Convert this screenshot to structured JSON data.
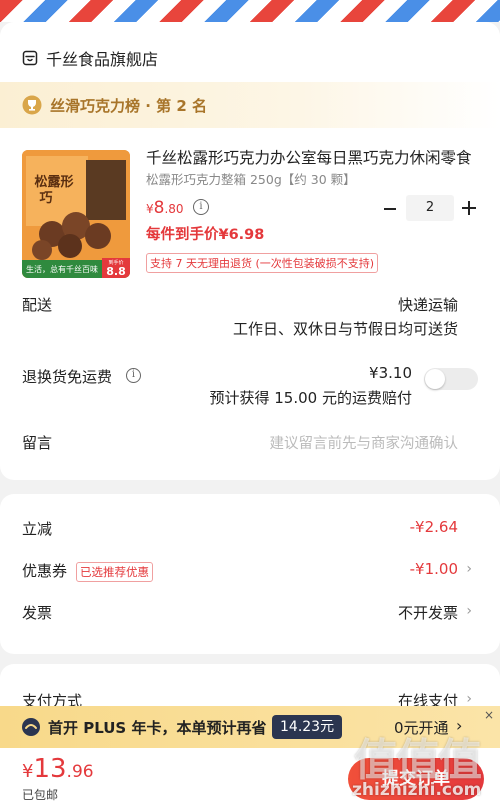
{
  "store": {
    "name": "千丝食品旗舰店",
    "icon": "store-icon"
  },
  "ranking": {
    "text": "丝滑巧克力榜 · 第 2 名",
    "icon": "trophy-icon"
  },
  "product": {
    "title": "千丝松露形巧克力办公室每日黑巧克力休闲零食",
    "spec": "松露形巧克力整箱 250g【约 30 颗】",
    "price_currency": "¥",
    "price_int": "8",
    "price_dec": ".80",
    "quantity": "2",
    "per_item_price": "每件到手价¥6.98",
    "return_policy": "支持 7 天无理由退货 (一次性包装破损不支持)",
    "image": {
      "box_text": "松露形巧克力",
      "badge_left": "生活，总有千丝百味",
      "badge_price": "8.8",
      "badge_price_label": "到手价"
    }
  },
  "delivery": {
    "label": "配送",
    "method": "快递运输",
    "schedule": "工作日、双休日与节假日均可送货"
  },
  "return_shipping": {
    "label": "退换货免运费",
    "price": "¥3.10",
    "note_prefix": "预计获得 ",
    "note_amount": "15.00",
    "note_suffix": " 元的运费赔付",
    "enabled": false
  },
  "message": {
    "label": "留言",
    "placeholder": "建议留言前先与商家沟通确认"
  },
  "discounts": {
    "instant_label": "立减",
    "instant_value": "-¥2.64",
    "coupon_label": "优惠券",
    "coupon_tag": "已选推荐优惠",
    "coupon_value": "-¥1.00",
    "invoice_label": "发票",
    "invoice_value": "不开发票"
  },
  "payment": {
    "label": "支付方式",
    "value": "在线支付"
  },
  "plus_banner": {
    "text": "首开 PLUS 年卡，本单预计再省",
    "save_amount": "14.23元",
    "button": "0元开通",
    "close": "×"
  },
  "bottom": {
    "currency": "¥",
    "total_int": "13",
    "total_dec": ".96",
    "shipping_note": "已包邮",
    "submit_label": "提交订单"
  },
  "watermark": {
    "logo": "值值值",
    "url": "zhizhizhi.com"
  },
  "colors": {
    "accent": "#e4393c",
    "gold": "#a8752a",
    "plus_bg": "#f8d98a",
    "plus_tag": "#2b3550"
  }
}
